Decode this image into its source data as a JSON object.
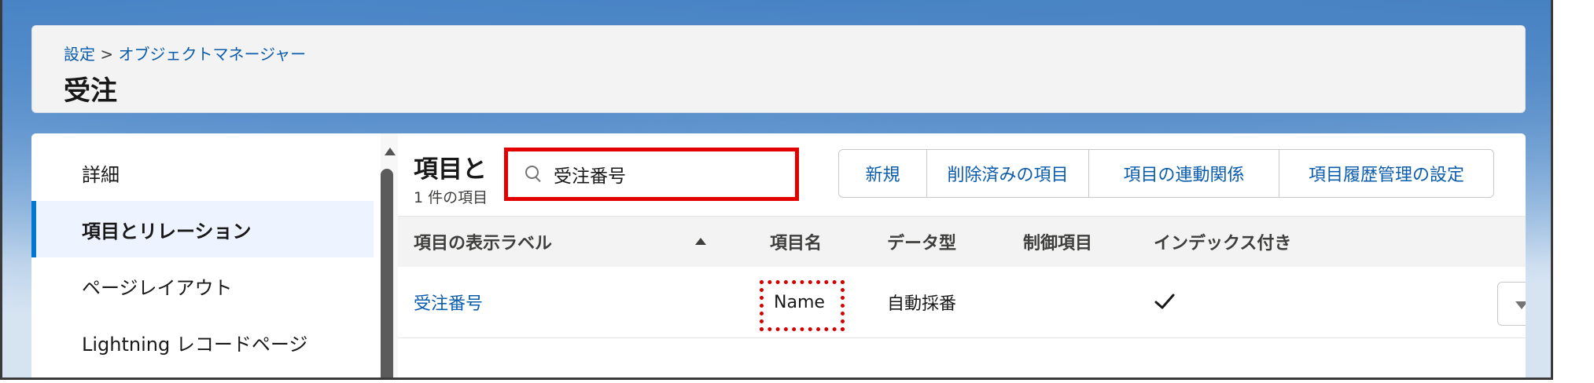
{
  "header": {
    "breadcrumb_root": "設定",
    "breadcrumb_sep": ">",
    "breadcrumb_current": "オブジェクトマネージャー",
    "title": "受注"
  },
  "sidebar": {
    "items": [
      {
        "label": "詳細",
        "active": false
      },
      {
        "label": "項目とリレーション",
        "active": true
      },
      {
        "label": "ページレイアウト",
        "active": false
      },
      {
        "label": "Lightning レコードページ",
        "active": false
      }
    ]
  },
  "main": {
    "section_title": "項目と",
    "count": "1 件の項目",
    "search": {
      "value": "受注番号",
      "icon": "search-icon"
    },
    "buttons": [
      "新規",
      "削除済みの項目",
      "項目の連動関係",
      "項目履歴管理の設定"
    ],
    "table": {
      "columns": [
        "項目の表示ラベル",
        "項目名",
        "データ型",
        "制御項目",
        "インデックス付き"
      ],
      "sorted_column": "項目の表示ラベル",
      "sort_direction": "ascending",
      "rows": [
        {
          "label": "受注番号",
          "api_name": "Name",
          "data_type": "自動採番",
          "controlling_field": "",
          "indexed": "✓"
        }
      ]
    }
  },
  "colors": {
    "accent": "#0176d3",
    "link": "#0b5cab",
    "highlight": "#e30000"
  }
}
